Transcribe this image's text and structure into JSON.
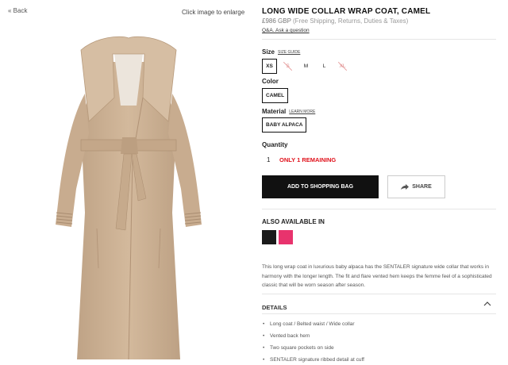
{
  "nav": {
    "back_label": "« Back"
  },
  "image_hint": "Click image to enlarge",
  "product": {
    "title": "LONG WIDE COLLAR WRAP COAT, CAMEL",
    "price": "£986 GBP",
    "shipping_note": "(Free Shipping, Returns, Duties & Taxes)",
    "qa_link": "Q&A. Ask a question"
  },
  "size": {
    "label": "Size",
    "guide_link": "SIZE GUIDE",
    "options": [
      {
        "label": "XS",
        "state": "selected"
      },
      {
        "label": "S",
        "state": "unavailable"
      },
      {
        "label": "M",
        "state": "available"
      },
      {
        "label": "L",
        "state": "available"
      },
      {
        "label": "XL",
        "state": "unavailable"
      }
    ]
  },
  "color": {
    "label": "Color",
    "selected": "CAMEL"
  },
  "material": {
    "label": "Material",
    "learn_link": "LEARN MORE",
    "selected": "BABY ALPACA"
  },
  "quantity": {
    "label": "Quantity",
    "value": "1",
    "stock_note": "ONLY 1 REMAINING"
  },
  "actions": {
    "add_to_bag": "ADD TO SHOPPING BAG",
    "share": "SHARE"
  },
  "also_available": {
    "label": "ALSO AVAILABLE IN",
    "swatches": [
      {
        "name": "black",
        "color": "#1a1a1a"
      },
      {
        "name": "pink",
        "color": "#e8336d"
      }
    ]
  },
  "description": "This long wrap coat in luxurious baby alpaca has the SENTALER signature wide collar that works in harmony with the longer length. The fit and flare vented hem keeps the femme feel of a sophisticated classic that will be worn season after season.",
  "details": {
    "label": "DETAILS",
    "bullets": [
      "Long coat / Belted waist / Wide collar",
      "Vented back hem",
      "Two square pockets on side",
      "SENTALER signature ribbed detail at cuff"
    ]
  },
  "colors": {
    "accent_red": "#e0111b",
    "button_black": "#111111",
    "coat_camel": "#cdb194"
  }
}
